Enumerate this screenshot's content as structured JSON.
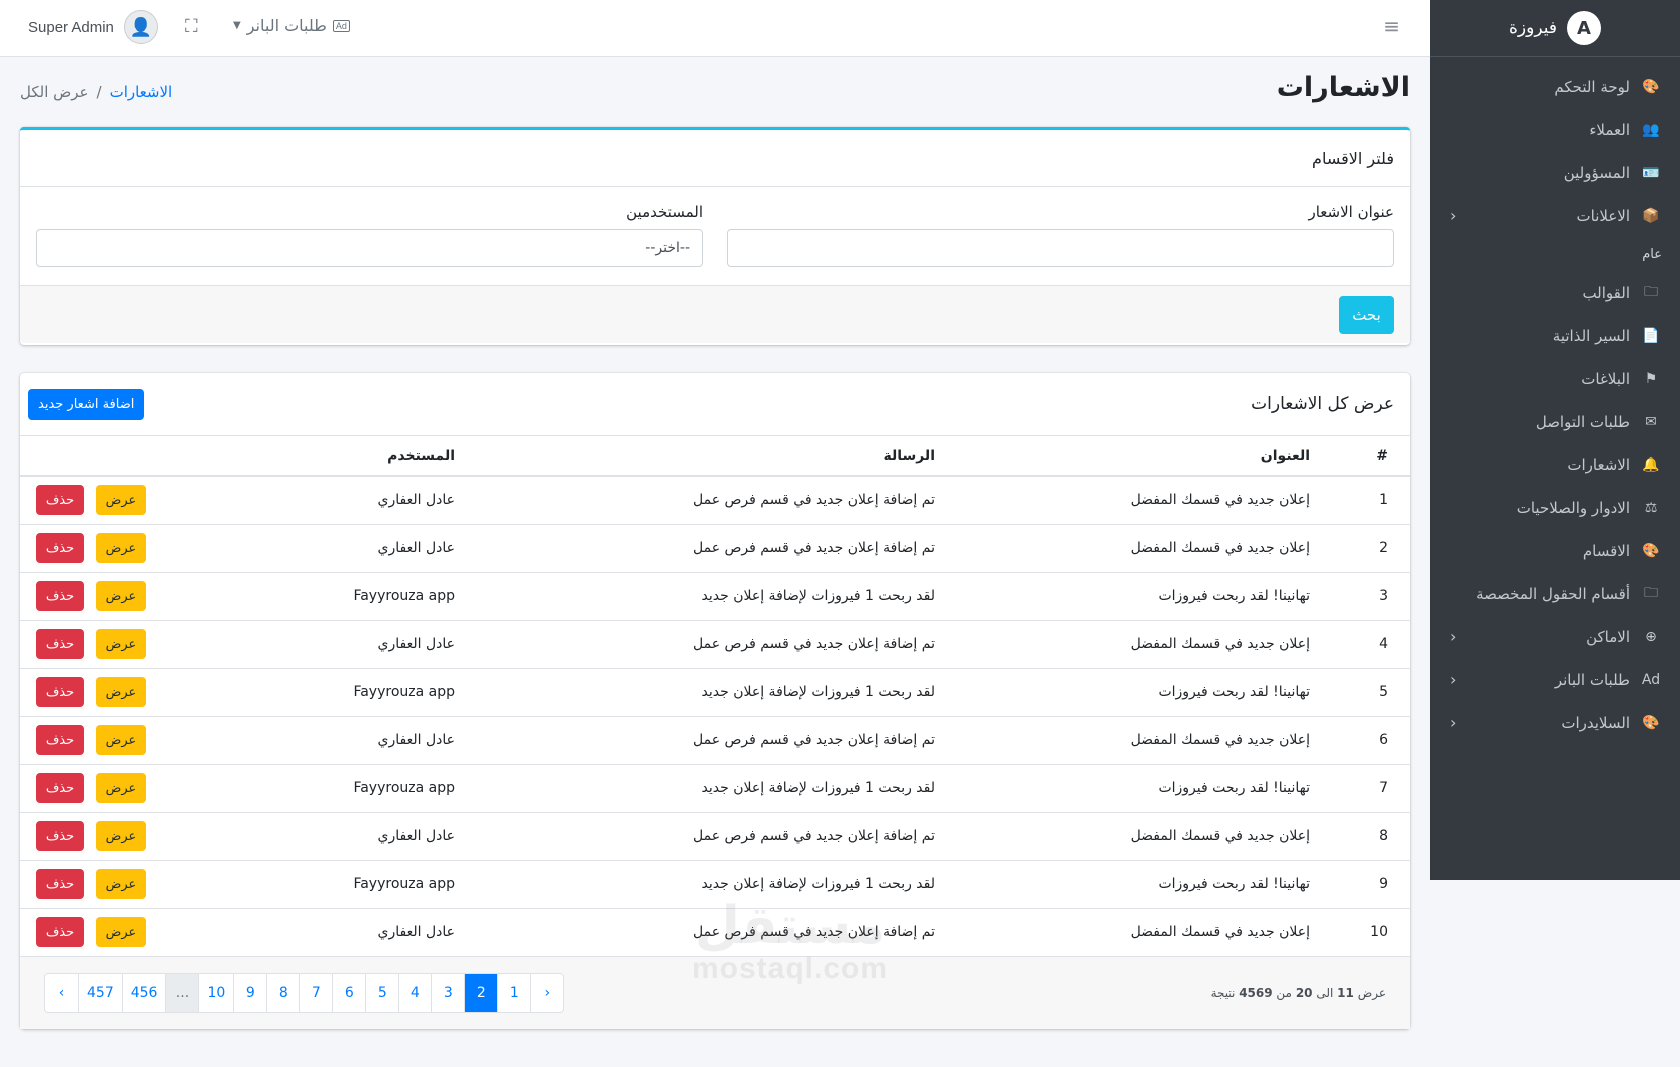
{
  "brand": {
    "name": "فيروزة",
    "logo_letter": "A"
  },
  "sidebar": {
    "items": [
      {
        "label": "لوحة التحكم",
        "icon": "🎨",
        "icon_name": "palette-icon",
        "chevron": false
      },
      {
        "label": "العملاء",
        "icon": "👥",
        "icon_name": "users-icon",
        "chevron": false
      },
      {
        "label": "المسؤولين",
        "icon": "🪪",
        "icon_name": "id-card-icon",
        "chevron": false
      },
      {
        "label": "الاعلانات",
        "icon": "📦",
        "icon_name": "box-icon",
        "chevron": true
      }
    ],
    "section_header": "عام",
    "items2": [
      {
        "label": "القوالب",
        "icon": "🗀",
        "icon_name": "folder-icon",
        "chevron": false
      },
      {
        "label": "السير الذاتية",
        "icon": "📄",
        "icon_name": "resume-icon",
        "chevron": false
      },
      {
        "label": "البلاغات",
        "icon": "⚑",
        "icon_name": "flag-icon",
        "chevron": false
      },
      {
        "label": "طلبات التواصل",
        "icon": "✉",
        "icon_name": "envelope-icon",
        "chevron": false
      },
      {
        "label": "الاشعارات",
        "icon": "🔔",
        "icon_name": "bell-icon",
        "chevron": false
      },
      {
        "label": "الادوار والصلاحيات",
        "icon": "⚖",
        "icon_name": "balance-icon",
        "chevron": false
      },
      {
        "label": "الاقسام",
        "icon": "🎨",
        "icon_name": "palette-icon",
        "chevron": false
      },
      {
        "label": "أقسام الحقول المخصصة",
        "icon": "🗀",
        "icon_name": "folder-plus-icon",
        "chevron": false
      },
      {
        "label": "الاماكن",
        "icon": "⊕",
        "icon_name": "location-icon",
        "chevron": true
      },
      {
        "label": "طلبات البانر",
        "icon": "Ad",
        "icon_name": "ad-icon",
        "chevron": true
      },
      {
        "label": "السلايدرات",
        "icon": "🎨",
        "icon_name": "palette-icon",
        "chevron": true
      }
    ]
  },
  "topbar": {
    "user_name": "Super Admin",
    "banner_menu_label": "طلبات البانر",
    "ad_badge": "Ad"
  },
  "page": {
    "title": "الاشعارات",
    "breadcrumb_link": "الاشعارات",
    "breadcrumb_sep": "/",
    "breadcrumb_current": "عرض الكل"
  },
  "filter": {
    "title": "فلتر الاقسام",
    "title_field_label": "عنوان الاشعار",
    "title_field_value": "",
    "users_field_label": "المستخدمين",
    "users_field_value": "--اختر--",
    "search_button": "بحث"
  },
  "list": {
    "title": "عرض كل الاشعارات",
    "add_button": "اضافة اشعار جديد",
    "columns": [
      "#",
      "العنوان",
      "الرسالة",
      "المستخدم"
    ],
    "view_label": "عرض",
    "delete_label": "حذف",
    "rows": [
      {
        "num": "1",
        "title": "إعلان جديد في قسمك المفضل",
        "message": "تم إضافة إعلان جديد في قسم فرص عمل",
        "user": "عادل العفاري"
      },
      {
        "num": "2",
        "title": "إعلان جديد في قسمك المفضل",
        "message": "تم إضافة إعلان جديد في قسم فرص عمل",
        "user": "عادل العفاري"
      },
      {
        "num": "3",
        "title": "تهانينا! لقد ربحت فيروزات",
        "message": "لقد ربحت 1 فيروزات لإضافة إعلان جديد",
        "user": "Fayyrouza app"
      },
      {
        "num": "4",
        "title": "إعلان جديد في قسمك المفضل",
        "message": "تم إضافة إعلان جديد في قسم فرص عمل",
        "user": "عادل العفاري"
      },
      {
        "num": "5",
        "title": "تهانينا! لقد ربحت فيروزات",
        "message": "لقد ربحت 1 فيروزات لإضافة إعلان جديد",
        "user": "Fayyrouza app"
      },
      {
        "num": "6",
        "title": "إعلان جديد في قسمك المفضل",
        "message": "تم إضافة إعلان جديد في قسم فرص عمل",
        "user": "عادل العفاري"
      },
      {
        "num": "7",
        "title": "تهانينا! لقد ربحت فيروزات",
        "message": "لقد ربحت 1 فيروزات لإضافة إعلان جديد",
        "user": "Fayyrouza app"
      },
      {
        "num": "8",
        "title": "إعلان جديد في قسمك المفضل",
        "message": "تم إضافة إعلان جديد في قسم فرص عمل",
        "user": "عادل العفاري"
      },
      {
        "num": "9",
        "title": "تهانينا! لقد ربحت فيروزات",
        "message": "لقد ربحت 1 فيروزات لإضافة إعلان جديد",
        "user": "Fayyrouza app"
      },
      {
        "num": "10",
        "title": "إعلان جديد في قسمك المفضل",
        "message": "تم إضافة إعلان جديد في قسم فرص عمل",
        "user": "عادل العفاري"
      }
    ]
  },
  "pagination": {
    "pages": [
      "‹",
      "1",
      "2",
      "3",
      "4",
      "5",
      "6",
      "7",
      "8",
      "9",
      "10",
      "...",
      "456",
      "457",
      "›"
    ],
    "active": "2",
    "results_prefix": "عرض",
    "results_from": "11",
    "results_to_word": "الى",
    "results_to": "20",
    "results_of_word": "من",
    "results_total": "4569",
    "results_suffix": "نتيجة"
  },
  "watermark": {
    "arabic": "مستقل",
    "latin": "mostaql.com"
  },
  "colors": {
    "sidebar_bg": "#343a40",
    "primary": "#007bff",
    "info": "#17c1e8",
    "warning": "#ffc107",
    "danger": "#dc3545"
  }
}
